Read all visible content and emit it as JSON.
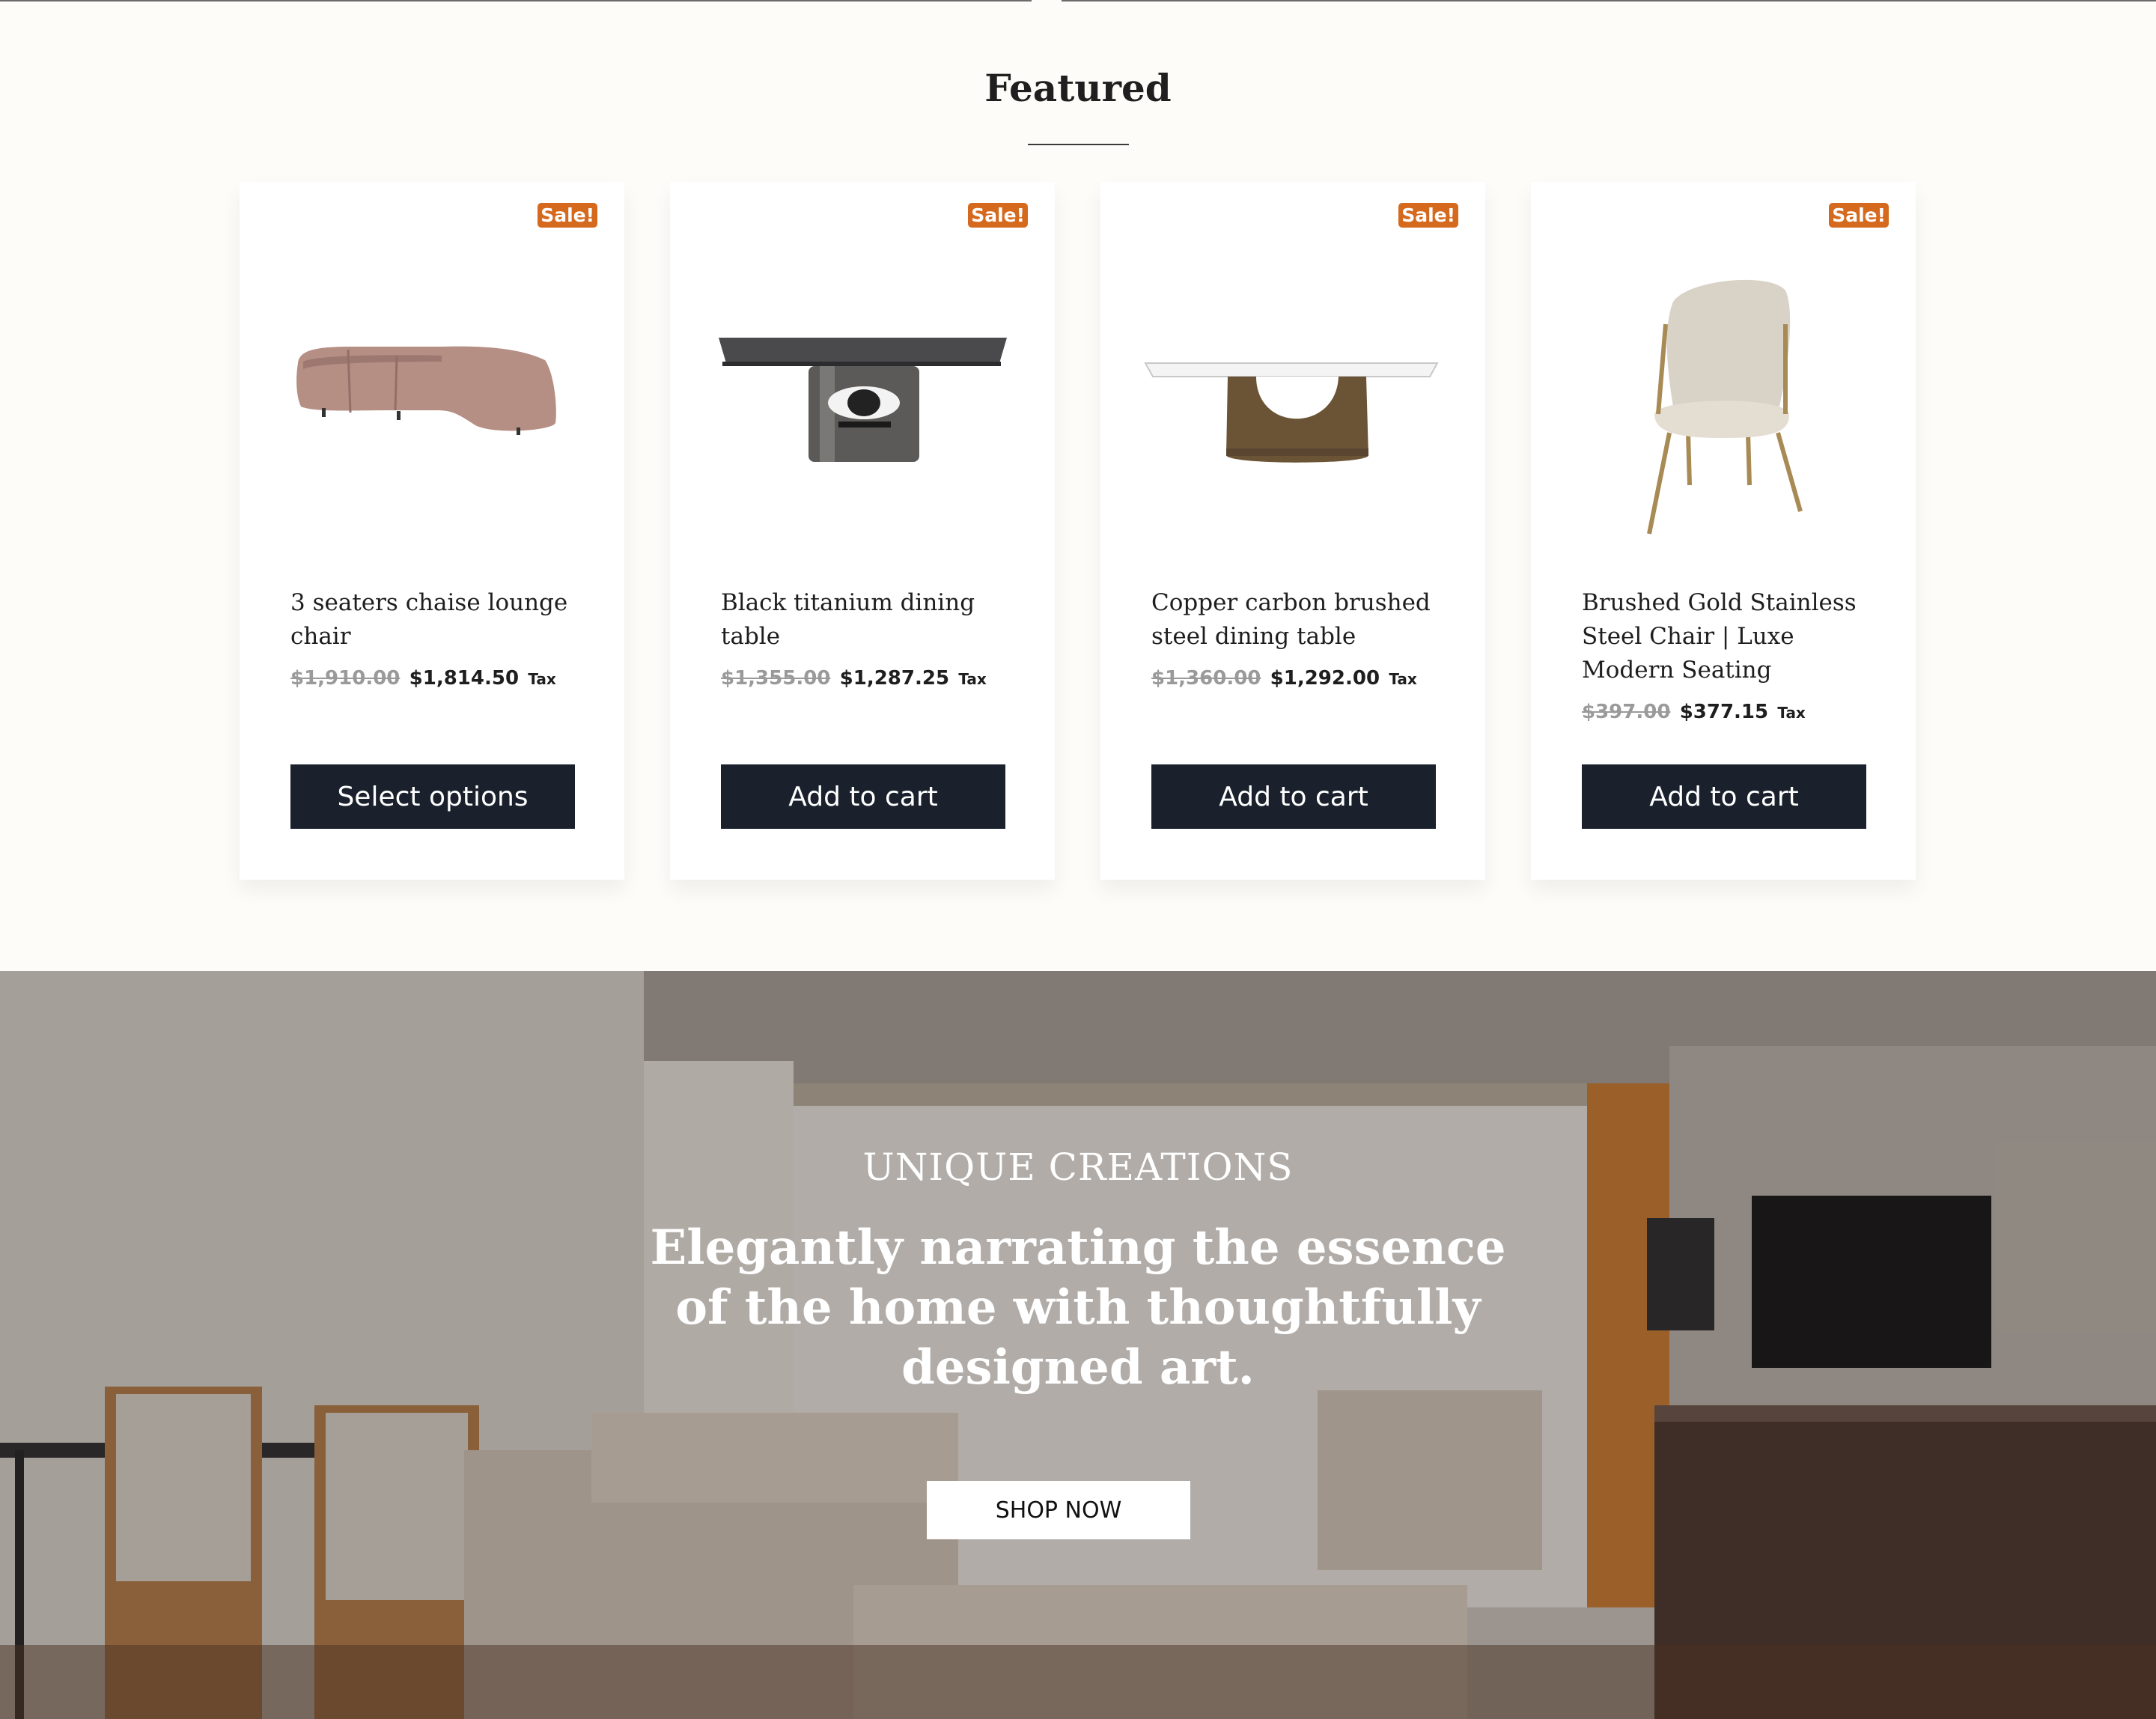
{
  "section": {
    "title": "Featured"
  },
  "products": [
    {
      "name": "3 seaters chaise lounge chair",
      "old_price": "$1,910.00",
      "new_price": "$1,814.50",
      "tax": "Tax",
      "badge": "Sale!",
      "button": "Select options",
      "image": "pink curved sectional sofa"
    },
    {
      "name": "Black titanium dining table",
      "old_price": "$1,355.00",
      "new_price": "$1,287.25",
      "tax": "Tax",
      "badge": "Sale!",
      "button": "Add to cart",
      "image": "dark marble table with metal pedestal"
    },
    {
      "name": "Copper carbon brushed steel dining table",
      "old_price": "$1,360.00",
      "new_price": "$1,292.00",
      "tax": "Tax",
      "badge": "Sale!",
      "button": "Add to cart",
      "image": "white top table with bronze U base"
    },
    {
      "name": "Brushed Gold Stainless Steel Chair | Luxe Modern Seating",
      "old_price": "$397.00",
      "new_price": "$377.15",
      "tax": "Tax",
      "badge": "Sale!",
      "button": "Add to cart",
      "image": "cream boucle chair with gold legs"
    }
  ],
  "hero": {
    "eyebrow": "UNIQUE CREATIONS",
    "headline": "Elegantly narrating the essence of the home with thoughtfully designed art.",
    "cta": "SHOP NOW",
    "image": "living room with sofa, dining table and tv"
  },
  "colors": {
    "badge": "#d56a1e",
    "button": "#1a212d",
    "background": "#fdfcf8"
  }
}
